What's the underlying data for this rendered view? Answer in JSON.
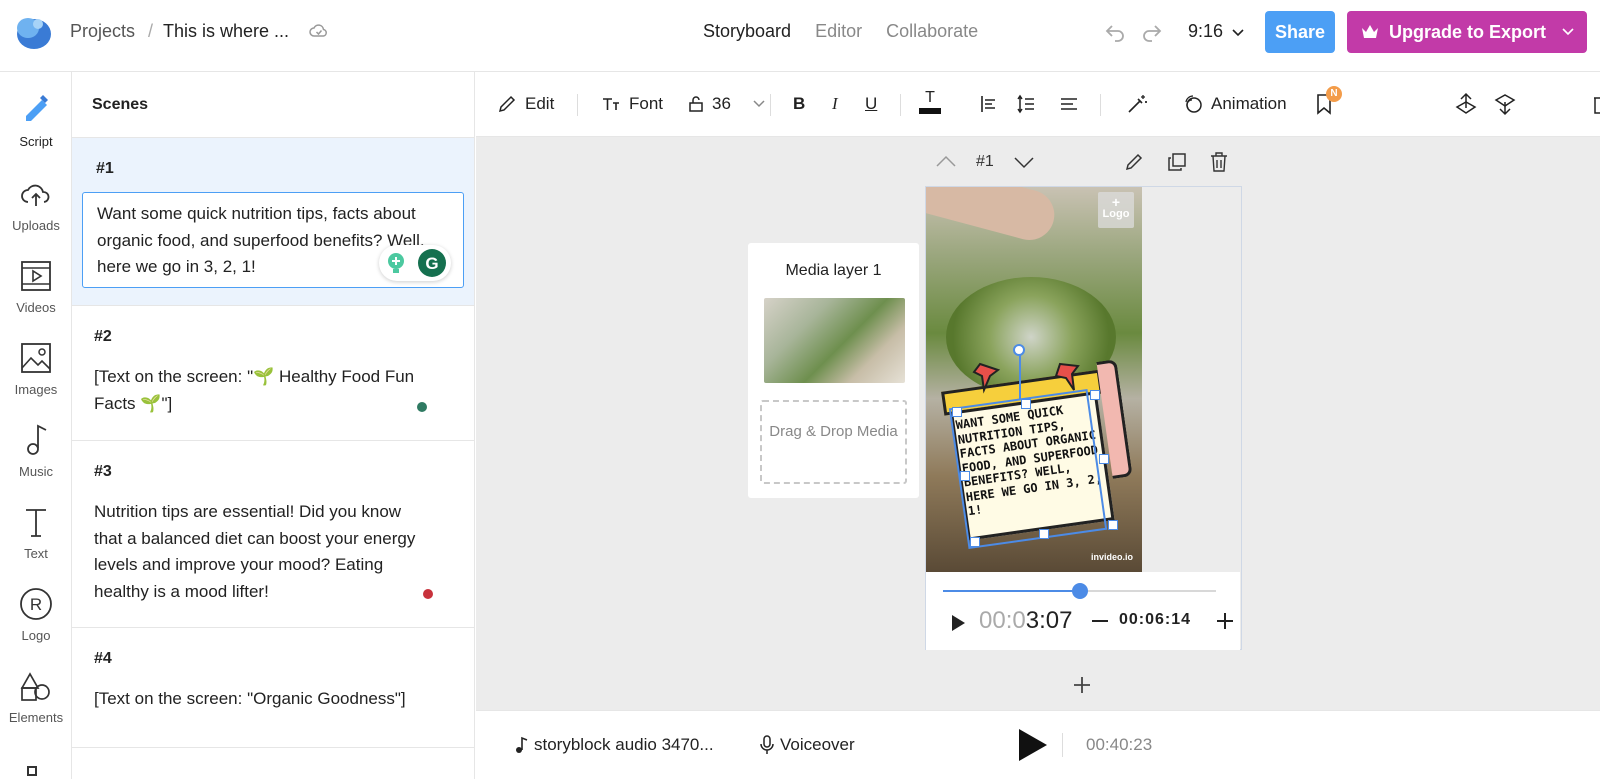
{
  "topbar": {
    "breadcrumb_root": "Projects",
    "breadcrumb_sep": "/",
    "project_title": "This is where ...",
    "modes": [
      "Storyboard",
      "Editor",
      "Collaborate"
    ],
    "aspect_ratio": "9:16",
    "share_label": "Share",
    "upgrade_label": "Upgrade to Export"
  },
  "leftnav": {
    "items": [
      {
        "label": "Script",
        "icon": "script-icon"
      },
      {
        "label": "Uploads",
        "icon": "upload-cloud-icon"
      },
      {
        "label": "Videos",
        "icon": "video-icon"
      },
      {
        "label": "Images",
        "icon": "image-icon"
      },
      {
        "label": "Music",
        "icon": "music-note-icon"
      },
      {
        "label": "Text",
        "icon": "text-icon"
      },
      {
        "label": "Logo",
        "icon": "registered-icon"
      },
      {
        "label": "Elements",
        "icon": "shapes-icon"
      }
    ]
  },
  "scenes": {
    "title": "Scenes",
    "items": [
      {
        "num": "#1",
        "text": "Want some quick nutrition tips, facts about organic food, and superfood benefits? Well, here we go in 3, 2, 1!"
      },
      {
        "num": "#2",
        "text": "[Text on the screen: \"🌱 Healthy Food Fun Facts 🌱\"]",
        "dot_color": "#2f7a62"
      },
      {
        "num": "#3",
        "text": "Nutrition tips are essential! Did you know that a balanced diet can boost your energy levels and improve your mood? Eating healthy is a mood lifter!",
        "dot_color": "#c8323c"
      },
      {
        "num": "#4",
        "text": "[Text on the screen: \"Organic Goodness\"]"
      }
    ]
  },
  "toolbar": {
    "edit_label": "Edit",
    "font_label": "Font",
    "font_size": "36",
    "bold": "B",
    "italic": "I",
    "underline": "U",
    "text_color_glyph": "T",
    "animation_label": "Animation",
    "badge": "N"
  },
  "canvas": {
    "scene_num": "#1",
    "media_layer_title": "Media layer 1",
    "drop_label": "Drag & Drop Media",
    "logo_label": "Logo",
    "watermark": "invideo.io",
    "overlay_text": "Want some quick nutrition tips, facts about organic food, and superfood benefits? Well, here we go in 3, 2, 1!",
    "time_dim": "00:0",
    "time_bright": "3:07",
    "duration": "00:06:14",
    "playhead_fraction": 0.5
  },
  "bottombar": {
    "audio_label": "storyblock audio 3470...",
    "voiceover_label": "Voiceover",
    "total_time": "00:40:23"
  },
  "colors": {
    "accent": "#4c9ff5",
    "upgrade": "#c23aa8",
    "selection": "#4c8be6"
  }
}
